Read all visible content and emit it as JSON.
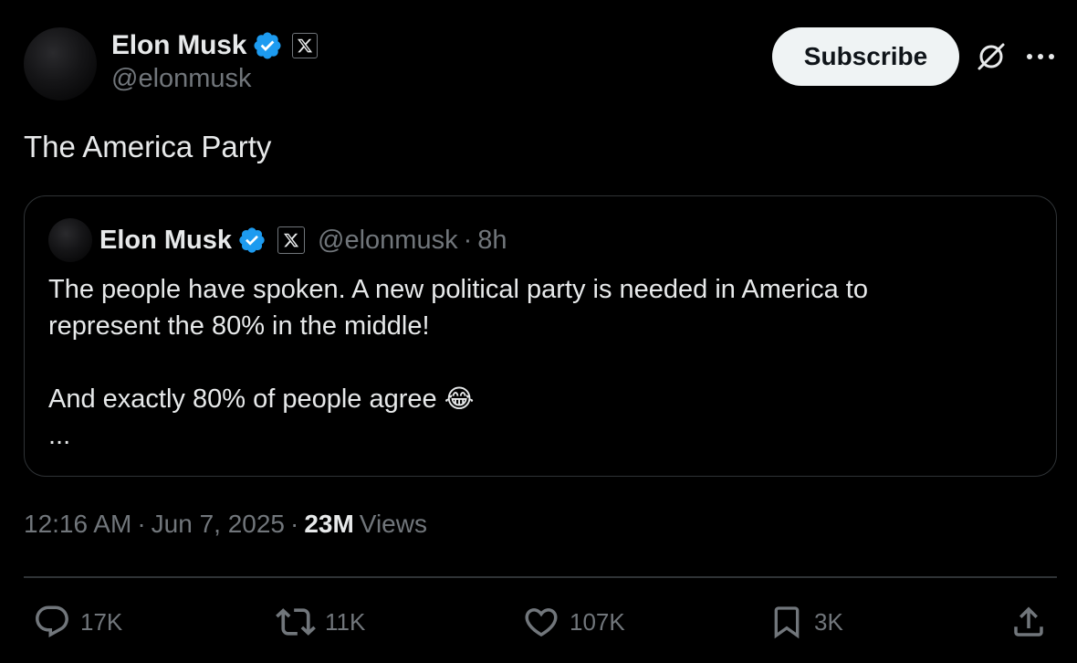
{
  "post": {
    "author": {
      "name": "Elon Musk",
      "handle": "@elonmusk"
    },
    "subscribe_label": "Subscribe",
    "text": "The America Party",
    "quote": {
      "author_name": "Elon Musk",
      "handle": "@elonmusk",
      "separator": "·",
      "time": "8h",
      "lines": [
        "The people have spoken. A new political party is needed in America to",
        "represent the 80% in the middle!",
        "",
        "And exactly 80% of people agree",
        "..."
      ],
      "emoji": "😂"
    },
    "meta": {
      "time": "12:16 AM",
      "sep1": "·",
      "date": "Jun 7, 2025",
      "sep2": "·",
      "views_count": "23M",
      "views_label": "Views"
    },
    "actions": {
      "replies": "17K",
      "reposts": "11K",
      "likes": "107K",
      "bookmarks": "3K"
    }
  },
  "colors": {
    "background": "#000000",
    "text_primary": "#e7e9ea",
    "text_secondary": "#71767b",
    "verified_blue": "#1d9bf0",
    "border": "#2f3336",
    "subscribe_bg": "#eff3f4"
  }
}
